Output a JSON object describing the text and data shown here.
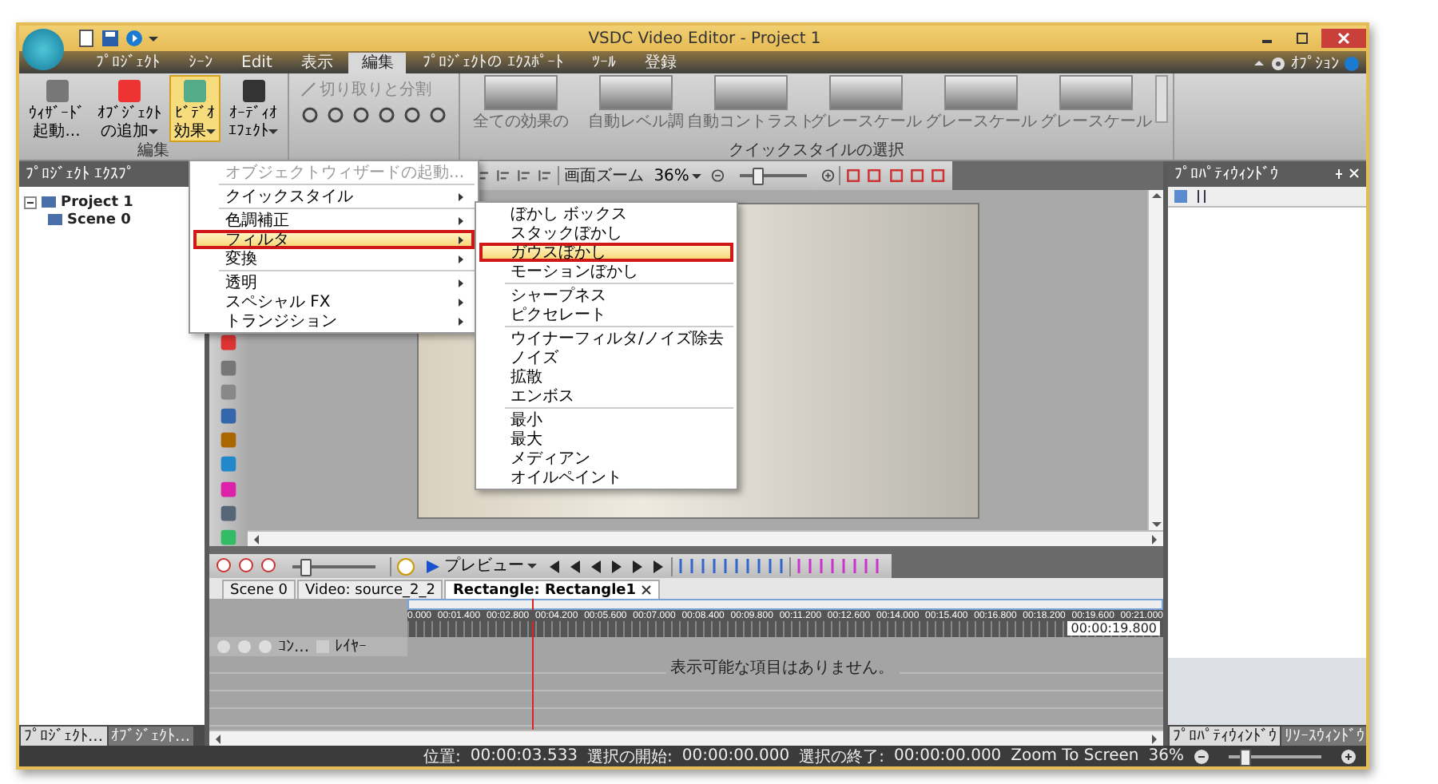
{
  "window": {
    "title": "VSDC Video Editor - Project 1",
    "options_label": "ｵﾌﾟｼｮﾝ"
  },
  "ribbon_tabs": [
    {
      "label": "ﾌﾟﾛｼﾞｪｸﾄ",
      "selected": false
    },
    {
      "label": "ｼｰﾝ",
      "selected": false
    },
    {
      "label": "Edit",
      "selected": false
    },
    {
      "label": "表示",
      "selected": false
    },
    {
      "label": "編集",
      "selected": true
    },
    {
      "label": "ﾌﾟﾛｼﾞｪｸﾄの ｴｸｽﾎﾟｰﾄ",
      "selected": false
    },
    {
      "label": "ﾂｰﾙ",
      "selected": false
    },
    {
      "label": "登録",
      "selected": false
    }
  ],
  "ribbon": {
    "buttons": [
      {
        "lines": [
          "ｳｨｻﾞｰﾄﾞ",
          "起動..."
        ],
        "dropdown": false,
        "selected": false
      },
      {
        "lines": [
          "ｵﾌﾞｼﾞｪｸﾄ",
          "の追加"
        ],
        "dropdown": true,
        "selected": false
      },
      {
        "lines": [
          "ﾋﾞﾃﾞｵ",
          "効果"
        ],
        "dropdown": true,
        "selected": true
      },
      {
        "lines": [
          "ｵｰﾃﾞｨｵ",
          "ｴﾌｪｸﾄ"
        ],
        "dropdown": true,
        "selected": false
      }
    ],
    "group_label": "編集",
    "split_label": "切り取りと分割",
    "quick_styles": {
      "label": "クイックスタイルの選択",
      "items": [
        "全ての効果の",
        "自動レベル調",
        "自動コントラスト",
        "グレースケール",
        "グレースケール",
        "グレースケール"
      ]
    }
  },
  "menu": {
    "groups": [
      [
        {
          "label": "オブジェクトウィザードの起動...",
          "disabled": true,
          "submenu": false,
          "selected": false
        }
      ],
      [
        {
          "label": "クイックスタイル",
          "disabled": false,
          "submenu": true,
          "selected": false
        }
      ],
      [
        {
          "label": "色調補正",
          "disabled": false,
          "submenu": true,
          "selected": false
        },
        {
          "label": "フィルタ",
          "disabled": false,
          "submenu": true,
          "selected": true
        },
        {
          "label": "変換",
          "disabled": false,
          "submenu": true,
          "selected": false
        }
      ],
      [
        {
          "label": "透明",
          "disabled": false,
          "submenu": true,
          "selected": false
        },
        {
          "label": "スペシャル FX",
          "disabled": false,
          "submenu": true,
          "selected": false
        },
        {
          "label": "トランジション",
          "disabled": false,
          "submenu": true,
          "selected": false
        }
      ]
    ]
  },
  "submenu": {
    "groups": [
      [
        {
          "label": "ぼかし ボックス",
          "selected": false
        },
        {
          "label": "スタックぼかし",
          "selected": false
        },
        {
          "label": "ガウスぼかし",
          "selected": true
        },
        {
          "label": "モーションぼかし",
          "selected": false
        }
      ],
      [
        {
          "label": "シャープネス",
          "selected": false
        },
        {
          "label": "ピクセレート",
          "selected": false
        }
      ],
      [
        {
          "label": "ウイナーフィルタ/ノイズ除去",
          "selected": false
        },
        {
          "label": "ノイズ",
          "selected": false
        },
        {
          "label": "拡散",
          "selected": false
        },
        {
          "label": "エンボス",
          "selected": false
        }
      ],
      [
        {
          "label": "最小",
          "selected": false
        },
        {
          "label": "最大",
          "selected": false
        },
        {
          "label": "メディアン",
          "selected": false
        },
        {
          "label": "オイルペイント",
          "selected": false
        }
      ]
    ]
  },
  "project_explorer": {
    "title": "ﾌﾟﾛｼﾞｪｸﾄ ｴｸｽﾌﾟ",
    "tree": [
      {
        "label": "Project 1",
        "expanded": true,
        "children": [
          {
            "label": "Scene 0"
          }
        ]
      }
    ],
    "tabs": [
      {
        "label": "ﾌﾟﾛｼﾞｪｸﾄ...",
        "selected": true
      },
      {
        "label": "ｵﾌﾞｼﾞｪｸﾄ...",
        "selected": false
      }
    ]
  },
  "toolbar": {
    "zoom_label": "画面ズーム",
    "zoom_value": "36%",
    "level": 0.22
  },
  "timeline": {
    "preview_label": "プレビュー",
    "zoom": {
      "level": 0.15
    },
    "tabs": [
      {
        "label": "Scene 0",
        "selected": false
      },
      {
        "label": "Video: source_2_2",
        "selected": false
      },
      {
        "label": "Rectangle: Rectangle1",
        "selected": true
      }
    ],
    "ruler": [
      "0.000",
      "00:01.400",
      "00:02.800",
      "00:04.200",
      "00:05.600",
      "00:07.000",
      "00:08.400",
      "00:09.800",
      "00:11.200",
      "00:12.600",
      "00:14.000",
      "00:15.400",
      "00:16.800",
      "00:18.200",
      "00:19.600",
      "00:21.000"
    ],
    "playhead": {
      "level": 0.165
    },
    "cursor_time": "00:00:19.800",
    "columns": [
      "ｺﾝ...",
      "ﾚｲﾔｰ"
    ],
    "empty_message": "表示可能な項目はありません。"
  },
  "properties": {
    "title": "ﾌﾟﾛﾊﾟﾃｨｳｨﾝﾄﾞｳ",
    "tabs": [
      {
        "label": "ﾌﾟﾛﾊﾟﾃｨｳｨﾝﾄﾞｳ",
        "selected": true
      },
      {
        "label": "ﾘｿｰｽｳｨﾝﾄﾞｳ",
        "selected": false
      }
    ]
  },
  "status_bar": {
    "fields": [
      {
        "label": "位置:",
        "value": "00:00:03.533"
      },
      {
        "label": "選択の開始:",
        "value": "00:00:00.000"
      },
      {
        "label": "選択の終了:",
        "value": "00:00:00.000"
      }
    ],
    "zoom_mode": "Zoom To Screen",
    "zoom_value": "36%",
    "level": 0.2
  }
}
